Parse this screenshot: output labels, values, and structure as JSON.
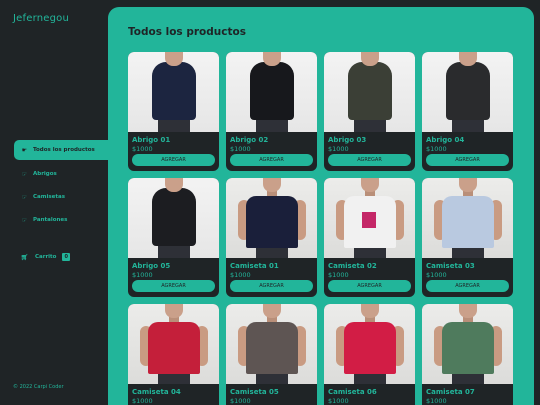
{
  "brand": "Jefernegou",
  "nav": [
    {
      "label": "Todos los productos",
      "active": true
    },
    {
      "label": "Abrigos",
      "active": false
    },
    {
      "label": "Camisetas",
      "active": false
    },
    {
      "label": "Pantalones",
      "active": false
    }
  ],
  "cart": {
    "label": "Carrito",
    "count": "0"
  },
  "footer": "© 2022 Carpi Coder",
  "page_title": "Todos los productos",
  "add_label": "AGREGAR",
  "products": [
    {
      "name": "Abrigo 01",
      "price": "$1000",
      "color": "#1c2540"
    },
    {
      "name": "Abrigo 02",
      "price": "$1000",
      "color": "#17181c"
    },
    {
      "name": "Abrigo 03",
      "price": "$1000",
      "color": "#3b3f36"
    },
    {
      "name": "Abrigo 04",
      "price": "$1000",
      "color": "#2a2b2d"
    },
    {
      "name": "Abrigo 05",
      "price": "$1000",
      "color": "#1c1d21"
    },
    {
      "name": "Camiseta 01",
      "price": "$1000",
      "color": "#1a1f3a"
    },
    {
      "name": "Camiseta 02",
      "price": "$1000",
      "color": "#f1f1f1"
    },
    {
      "name": "Camiseta 03",
      "price": "$1000",
      "color": "#b9c9e0"
    },
    {
      "name": "Camiseta 04",
      "price": "$1000",
      "color": "#c41f3a"
    },
    {
      "name": "Camiseta 05",
      "price": "$1000",
      "color": "#5e5553"
    },
    {
      "name": "Camiseta 06",
      "price": "$1000",
      "color": "#d21d45"
    },
    {
      "name": "Camiseta 07",
      "price": "$1000",
      "color": "#4f7b5d"
    }
  ]
}
